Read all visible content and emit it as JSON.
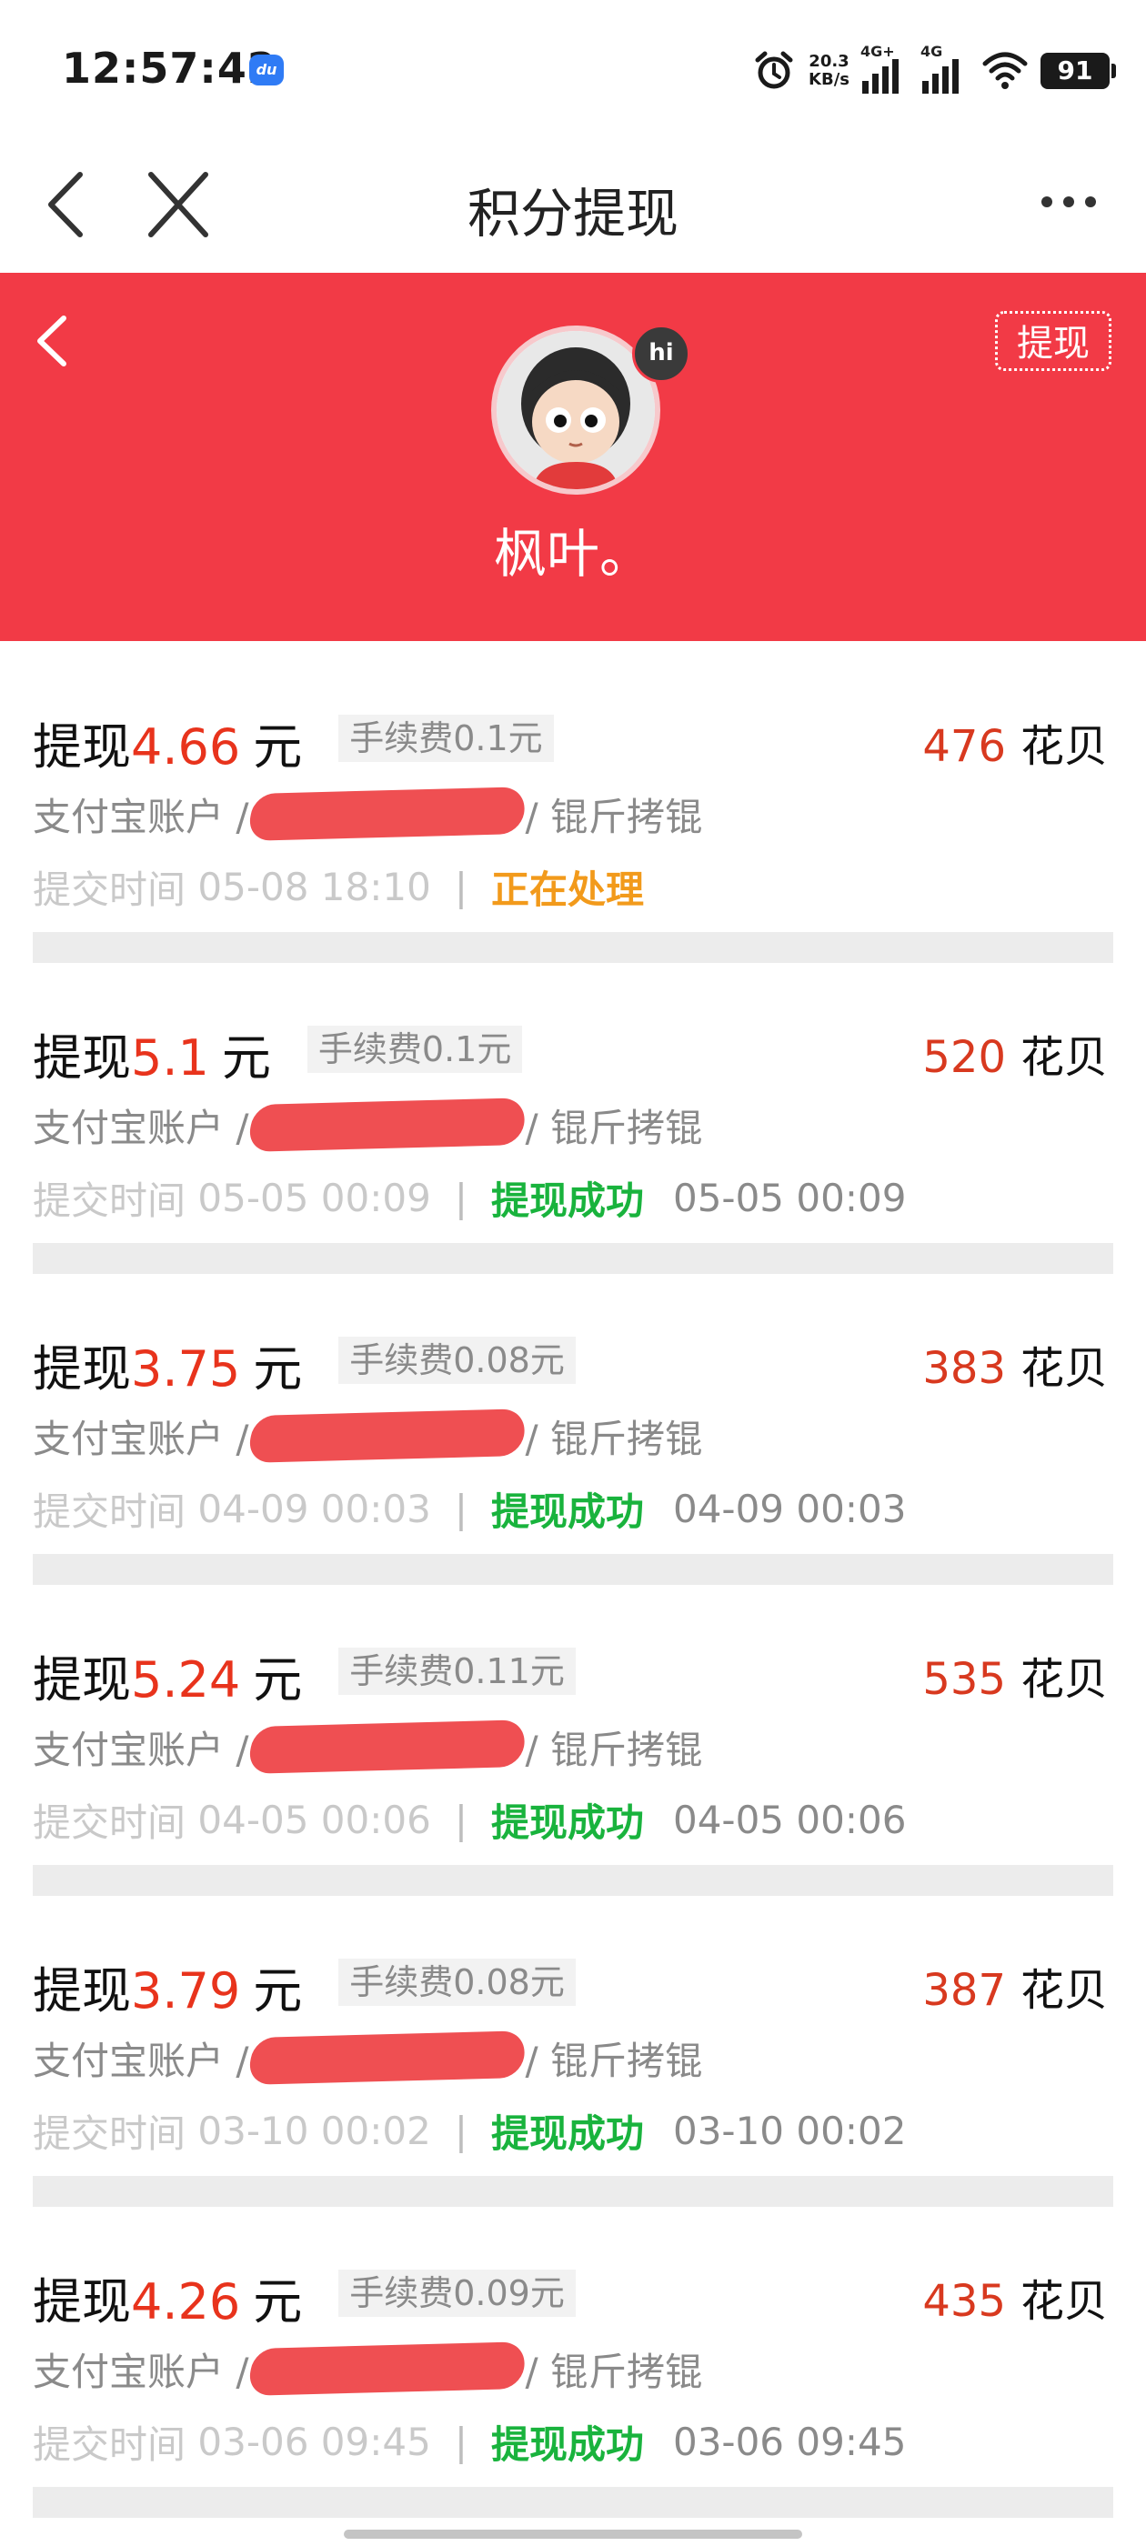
{
  "status_bar": {
    "time": "12:57:42",
    "app_badge": "du",
    "net_speed_value": "20.3",
    "net_speed_unit": "KB/s",
    "sim1_label": "4G+",
    "sim2_label": "4G",
    "battery": "91"
  },
  "nav": {
    "title": "积分提现"
  },
  "profile": {
    "username": "枫叶。",
    "avatar_badge": "hi",
    "withdraw_button": "提现"
  },
  "labels": {
    "withdraw_prefix": "提现",
    "currency_unit": "元",
    "points_unit": "花贝",
    "account_prefix": "支付宝账户 /",
    "account_suffix": "/ 锟斤拷锟",
    "submit_prefix": "提交时间",
    "separator": "|"
  },
  "records": [
    {
      "amount": "4.66",
      "fee": "手续费0.1元",
      "points": "476",
      "submit_time": "05-08 18:10",
      "status": "正在处理",
      "status_type": "processing",
      "done_time": ""
    },
    {
      "amount": "5.1",
      "fee": "手续费0.1元",
      "points": "520",
      "submit_time": "05-05 00:09",
      "status": "提现成功",
      "status_type": "success",
      "done_time": "05-05 00:09"
    },
    {
      "amount": "3.75",
      "fee": "手续费0.08元",
      "points": "383",
      "submit_time": "04-09 00:03",
      "status": "提现成功",
      "status_type": "success",
      "done_time": "04-09 00:03"
    },
    {
      "amount": "5.24",
      "fee": "手续费0.11元",
      "points": "535",
      "submit_time": "04-05 00:06",
      "status": "提现成功",
      "status_type": "success",
      "done_time": "04-05 00:06"
    },
    {
      "amount": "3.79",
      "fee": "手续费0.08元",
      "points": "387",
      "submit_time": "03-10 00:02",
      "status": "提现成功",
      "status_type": "success",
      "done_time": "03-10 00:02"
    },
    {
      "amount": "4.26",
      "fee": "手续费0.09元",
      "points": "435",
      "submit_time": "03-06 09:45",
      "status": "提现成功",
      "status_type": "success",
      "done_time": "03-06 09:45"
    }
  ],
  "colors": {
    "header_red": "#f23a46",
    "amount_red": "#e8331c",
    "processing_orange": "#f29a1b",
    "success_green": "#19b33d"
  },
  "icons": {
    "nav_back": "chevron-left-icon",
    "nav_close": "close-icon",
    "nav_more": "more-dots-icon",
    "profile_back": "chevron-left-icon",
    "alarm": "alarm-clock-icon",
    "wifi": "wifi-icon"
  }
}
